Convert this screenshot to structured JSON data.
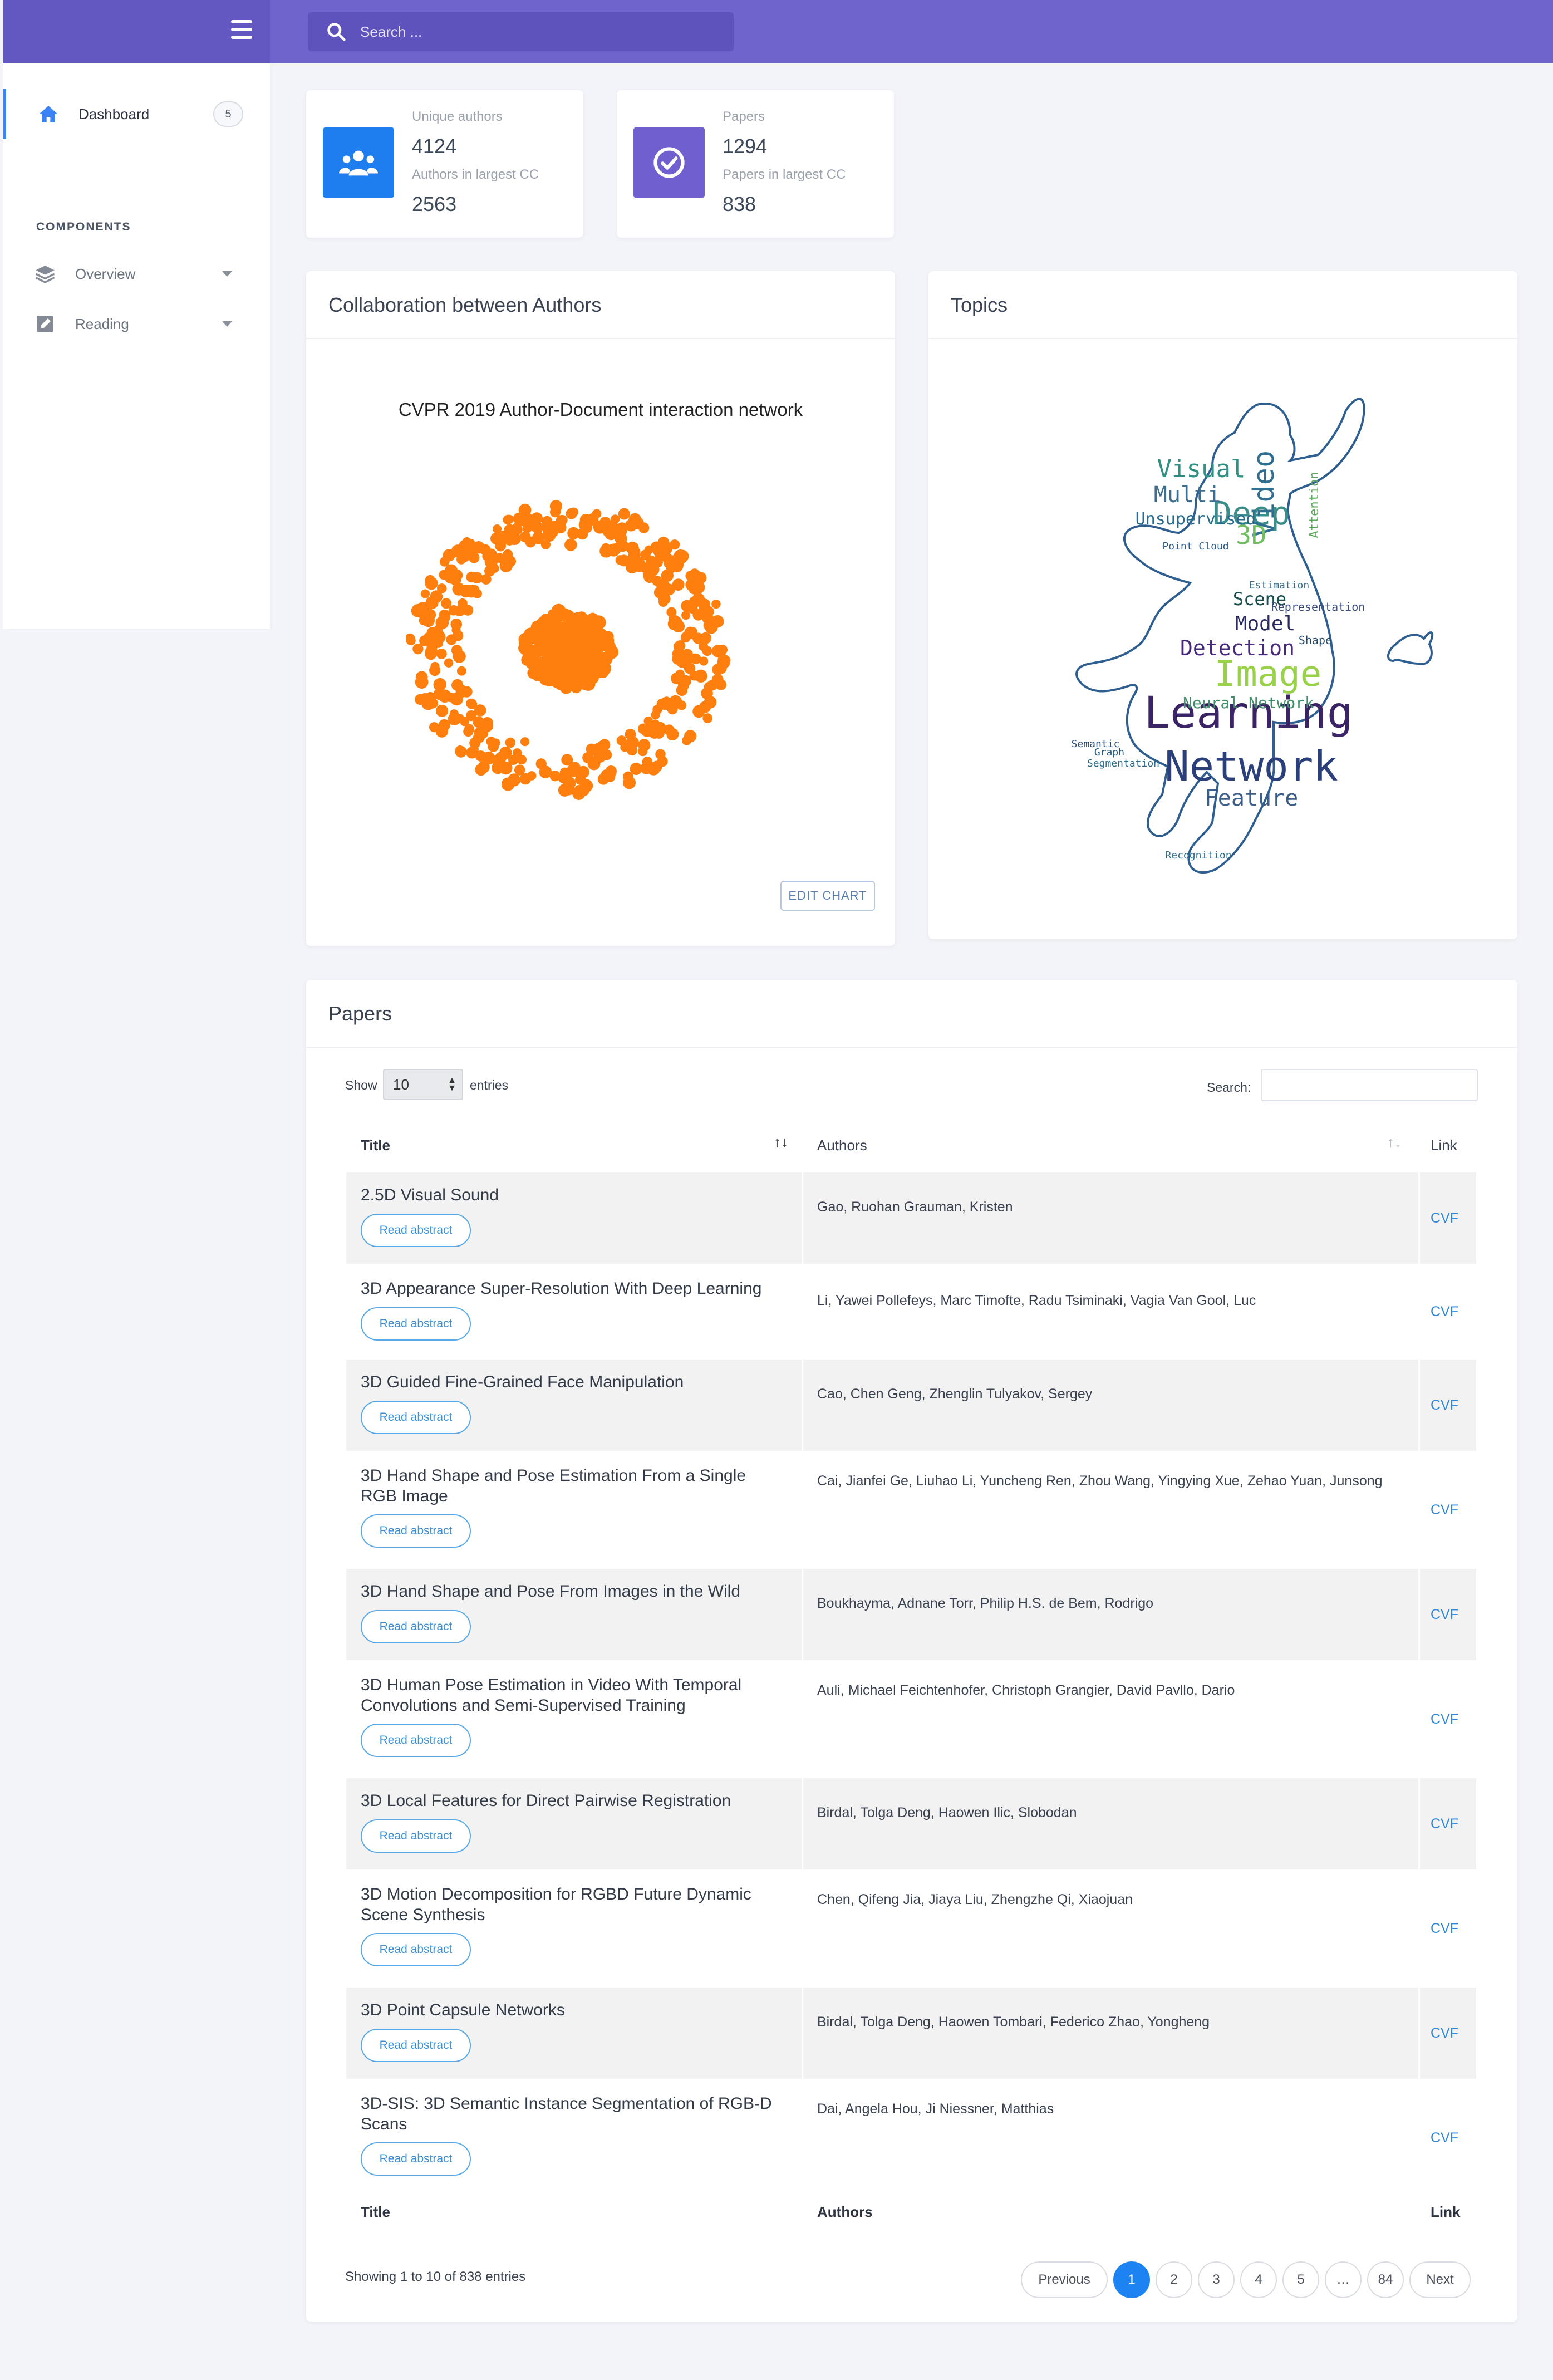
{
  "search": {
    "placeholder": "Search ..."
  },
  "sidebar": {
    "dashboard": {
      "label": "Dashboard",
      "badge": "5"
    },
    "section": "COMPONENTS",
    "items": [
      {
        "label": "Overview",
        "icon": "layers-icon"
      },
      {
        "label": "Reading",
        "icon": "edit-icon"
      }
    ]
  },
  "stats": [
    {
      "label": "Unique authors",
      "value": "4124",
      "sub_label": "Authors in largest CC",
      "sub_value": "2563",
      "icon": "users-icon",
      "color": "#1e7ef0"
    },
    {
      "label": "Papers",
      "value": "1294",
      "sub_label": "Papers in largest CC",
      "sub_value": "838",
      "icon": "check-circle-icon",
      "color": "#6f5fcf"
    }
  ],
  "collab": {
    "card_title": "Collaboration between Authors",
    "chart_title": "CVPR 2019 Author-Document interaction network",
    "edit_label": "EDIT CHART",
    "node_color": "#ff7f0e"
  },
  "topics": {
    "card_title": "Topics",
    "words": [
      "Learning",
      "Network",
      "Image",
      "Deep",
      "Video",
      "Visual",
      "Multi",
      "3D",
      "Detection",
      "Feature",
      "Model",
      "Scene",
      "Unsupervised",
      "Neural Network",
      "Attention",
      "Semantic",
      "Graph",
      "Segmentation",
      "Representation",
      "Shape",
      "Recognition",
      "Point Cloud",
      "Estimation"
    ]
  },
  "papers": {
    "card_title": "Papers",
    "show_label": "Show",
    "entries_value": "10",
    "entries_label": "entries",
    "search_label": "Search:",
    "headers": {
      "title": "Title",
      "authors": "Authors",
      "link": "Link"
    },
    "read_label": "Read abstract",
    "rows": [
      {
        "title": "2.5D Visual Sound",
        "authors": "Gao, Ruohan Grauman, Kristen",
        "link": "CVF"
      },
      {
        "title": "3D Appearance Super-Resolution With Deep Learning",
        "authors": "Li, Yawei Pollefeys, Marc Timofte, Radu Tsiminaki, Vagia Van Gool, Luc",
        "link": "CVF"
      },
      {
        "title": "3D Guided Fine-Grained Face Manipulation",
        "authors": "Cao, Chen Geng, Zhenglin Tulyakov, Sergey",
        "link": "CVF"
      },
      {
        "title": "3D Hand Shape and Pose Estimation From a Single RGB Image",
        "authors": "Cai, Jianfei Ge, Liuhao Li, Yuncheng Ren, Zhou Wang, Yingying Xue, Zehao Yuan, Junsong",
        "link": "CVF"
      },
      {
        "title": "3D Hand Shape and Pose From Images in the Wild",
        "authors": "Boukhayma, Adnane Torr, Philip H.S. de Bem, Rodrigo",
        "link": "CVF"
      },
      {
        "title": "3D Human Pose Estimation in Video With Temporal Convolutions and Semi-Supervised Training",
        "authors": "Auli, Michael Feichtenhofer, Christoph Grangier, David Pavllo, Dario",
        "link": "CVF"
      },
      {
        "title": "3D Local Features for Direct Pairwise Registration",
        "authors": "Birdal, Tolga Deng, Haowen Ilic, Slobodan",
        "link": "CVF"
      },
      {
        "title": "3D Motion Decomposition for RGBD Future Dynamic Scene Synthesis",
        "authors": "Chen, Qifeng Jia, Jiaya Liu, Zhengzhe Qi, Xiaojuan",
        "link": "CVF"
      },
      {
        "title": "3D Point Capsule Networks",
        "authors": "Birdal, Tolga Deng, Haowen Tombari, Federico Zhao, Yongheng",
        "link": "CVF"
      },
      {
        "title": "3D-SIS: 3D Semantic Instance Segmentation of RGB-D Scans",
        "authors": "Dai, Angela Hou, Ji Niessner, Matthias",
        "link": "CVF"
      }
    ],
    "info": "Showing 1 to 10 of 838 entries",
    "pagination": {
      "previous": "Previous",
      "pages": [
        "1",
        "2",
        "3",
        "4",
        "5",
        "…",
        "84"
      ],
      "next": "Next",
      "current": "1"
    }
  }
}
